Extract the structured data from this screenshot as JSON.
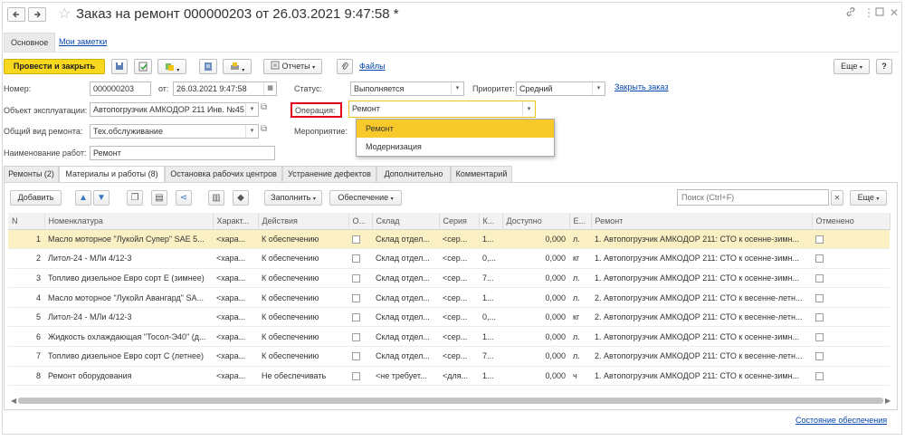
{
  "window": {
    "title": "Заказ на ремонт 000000203 от 26.03.2021 9:47:58 *",
    "back_icon": "arrow-left-icon",
    "forward_icon": "arrow-right-icon",
    "star_icon": "star-icon",
    "link_icon": "link-icon",
    "more_icon": "kebab-icon",
    "maximize_icon": "maximize-icon",
    "close_icon": "close-icon"
  },
  "top_tabs": [
    {
      "label": "Основное",
      "active": true
    },
    {
      "label": "Мои заметки",
      "active": false
    }
  ],
  "toolbar": {
    "post_close": "Провести и закрыть",
    "reports": "Отчеты",
    "files": "Файлы",
    "more": "Еще"
  },
  "header": {
    "number_label": "Номер:",
    "number_value": "000000203",
    "from_label": "от:",
    "date_value": "26.03.2021  9:47:58",
    "status_label": "Статус:",
    "status_value": "Выполняется",
    "priority_label": "Приоритет:",
    "priority_value": "Средний",
    "close_order_link": "Закрыть заказ",
    "object_label": "Объект эксплуатации:",
    "object_value": "Автопогрузчик АМКОДОР 211 Инв. №45",
    "operation_label": "Операция:",
    "operation_value": "Ремонт",
    "repair_type_label": "Общий вид ремонта:",
    "repair_type_value": "Тех.обслуживание",
    "event_label": "Мероприятие:",
    "work_name_label": "Наименование работ:",
    "work_name_value": "Ремонт"
  },
  "operation_dropdown": {
    "options": [
      "Ремонт",
      "Модернизация"
    ],
    "highlighted": 0
  },
  "section_tabs": [
    {
      "label": "Ремонты (2)",
      "active": false
    },
    {
      "label": "Материалы и работы (8)",
      "active": true
    },
    {
      "label": "Остановка рабочих центров",
      "active": false
    },
    {
      "label": "Устранение дефектов",
      "active": false
    },
    {
      "label": "Дополнительно",
      "active": false
    },
    {
      "label": "Комментарий",
      "active": false
    }
  ],
  "table_toolbar": {
    "add": "Добавить",
    "fill": "Заполнить",
    "supply": "Обеспечение",
    "search_placeholder": "Поиск (Ctrl+F)",
    "more": "Еще"
  },
  "table": {
    "columns": [
      "N",
      "Номенклатура",
      "Характ...",
      "Действия",
      "О...",
      "Склад",
      "Серия",
      "К...",
      "Доступно",
      "Е...",
      "Ремонт",
      "Отменено"
    ],
    "rows": [
      {
        "n": "1",
        "item": "Масло моторное \"Лукойл Супер\" SAE 5...",
        "char": "<хара...",
        "action": "К обеспечению",
        "warehouse": "Склад отдел...",
        "series": "<сер...",
        "qty": "1...",
        "available": "0,000",
        "unit": "л.",
        "repair": "1. Автопогрузчик АМКОДОР 211: СТО к осенне-зимн..."
      },
      {
        "n": "2",
        "item": "Литол-24 - МЛи 4/12-3",
        "char": "<хара...",
        "action": "К обеспечению",
        "warehouse": "Склад отдел...",
        "series": "<сер...",
        "qty": "0,...",
        "available": "0,000",
        "unit": "кг",
        "repair": "1. Автопогрузчик АМКОДОР 211: СТО к осенне-зимн..."
      },
      {
        "n": "3",
        "item": "Топливо дизельное Евро сорт Е (зимнее)",
        "char": "<хара...",
        "action": "К обеспечению",
        "warehouse": "Склад отдел...",
        "series": "<сер...",
        "qty": "7...",
        "available": "0,000",
        "unit": "л.",
        "repair": "1. Автопогрузчик АМКОДОР 211: СТО к осенне-зимн..."
      },
      {
        "n": "4",
        "item": "Масло моторное \"Лукойл Авангард\" SA...",
        "char": "<хара...",
        "action": "К обеспечению",
        "warehouse": "Склад отдел...",
        "series": "<сер...",
        "qty": "1...",
        "available": "0,000",
        "unit": "л.",
        "repair": "2. Автопогрузчик АМКОДОР 211: СТО к весенне-летн..."
      },
      {
        "n": "5",
        "item": "Литол-24 - МЛи 4/12-3",
        "char": "<хара...",
        "action": "К обеспечению",
        "warehouse": "Склад отдел...",
        "series": "<сер...",
        "qty": "0,...",
        "available": "0,000",
        "unit": "кг",
        "repair": "2. Автопогрузчик АМКОДОР 211: СТО к весенне-летн..."
      },
      {
        "n": "6",
        "item": "Жидкость охлаждающая \"Тосол-Э40\" (д...",
        "char": "<хара...",
        "action": "К обеспечению",
        "warehouse": "Склад отдел...",
        "series": "<сер...",
        "qty": "1...",
        "available": "0,000",
        "unit": "л.",
        "repair": "1. Автопогрузчик АМКОДОР 211: СТО к осенне-зимн..."
      },
      {
        "n": "7",
        "item": "Топливо дизельное Евро сорт С (летнее)",
        "char": "<хара...",
        "action": "К обеспечению",
        "warehouse": "Склад отдел...",
        "series": "<сер...",
        "qty": "7...",
        "available": "0,000",
        "unit": "л.",
        "repair": "2. Автопогрузчик АМКОДОР 211: СТО к весенне-летн..."
      },
      {
        "n": "8",
        "item": "Ремонт оборудования",
        "char": "<хара...",
        "action": "Не обеспечивать",
        "warehouse": "<не требует...",
        "series": "<для...",
        "qty": "1...",
        "available": "0,000",
        "unit": "ч",
        "repair": "1. Автопогрузчик АМКОДОР 211: СТО к осенне-зимн..."
      }
    ]
  },
  "footer": {
    "supply_status_link": "Состояние обеспечения"
  },
  "colors": {
    "primary_button": "#f8d81c",
    "selected_row": "#fbf0c3",
    "dropdown_highlight": "#f8c92a",
    "operation_label_border": "#e2001a",
    "link": "#0645ad"
  }
}
